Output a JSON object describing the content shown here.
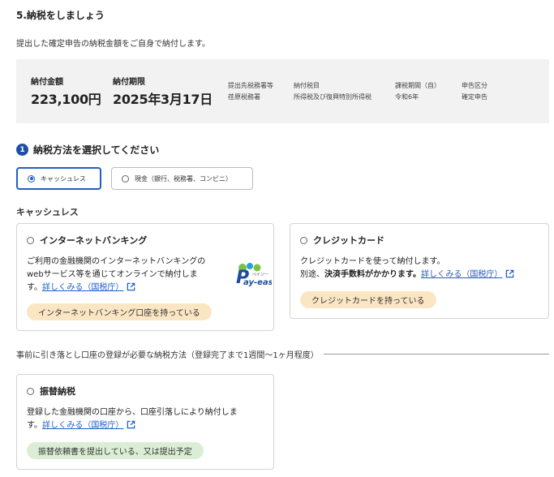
{
  "section": {
    "title": "5.納税をしましょう",
    "intro": "提出した確定申告の納税金額をご自身で納付します。"
  },
  "summary": {
    "amount_label": "納付金額",
    "amount_value": "223,100円",
    "deadline_label": "納付期限",
    "deadline_value": "2025年3月17日",
    "meta": [
      {
        "label": "提出先税務署等",
        "value": "荏原税務署"
      },
      {
        "label": "納付税目",
        "value": "所得税及び復興特別所得税"
      },
      {
        "label": "課税期間（自）",
        "value": "令和6年"
      },
      {
        "label": "申告区分",
        "value": "確定申告"
      }
    ]
  },
  "step": {
    "number": "1",
    "title": "納税方法を選択してください"
  },
  "methods": {
    "cashless_label": "キャッシュレス",
    "cash_label": "現金（銀行、税務署、コンビニ）",
    "selected": "cashless"
  },
  "cashless_group": {
    "label": "キャッシュレス"
  },
  "internet_banking": {
    "title": "インターネットバンキング",
    "desc_line1": "ご利用の金融機関のインターネットバンキングの",
    "desc_line2": "webサービス等を通じてオンラインで納付しま",
    "desc_line3_prefix": "す。",
    "link": "詳しくみる（国税庁）",
    "tag": "インターネットバンキング口座を持っている",
    "logo_small": "ペイジー",
    "logo_text": "ay-easy"
  },
  "credit_card": {
    "title": "クレジットカード",
    "desc_line1": "クレジットカードを使って納付します。",
    "desc_line2_prefix": "別途、",
    "desc_line2_bold": "決済手数料がかかります。",
    "link": "詳しくみる（国税庁）",
    "tag": "クレジットカードを持っている"
  },
  "divider": {
    "text": "事前に引き落とし口座の登録が必要な納税方法（登録完了まで1週間〜1ヶ月程度）"
  },
  "furikae": {
    "title": "振替納税",
    "desc_line1": "登録した金融機関の口座から、口座引落しにより納付しま",
    "desc_line2_prefix": "す。",
    "link": "詳しくみる（国税庁）",
    "tag": "振替依頼書を提出している、又は提出予定"
  },
  "colors": {
    "accent": "#1f5fc7",
    "step_badge": "#1f4ea8",
    "summary_bg": "#f2f2f2",
    "tag_orange": "#fbe6c4",
    "tag_green": "#dbeed5"
  }
}
